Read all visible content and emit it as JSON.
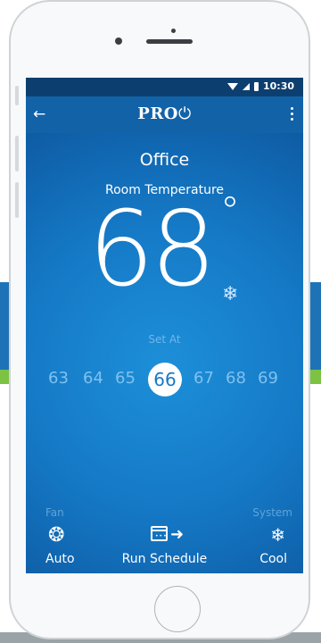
{
  "status_bar": {
    "time": "10:30"
  },
  "app_bar": {
    "logo_text": "PRO"
  },
  "room": {
    "name": "Office",
    "label": "Room Temperature"
  },
  "temperature": {
    "current": "68",
    "unit_symbol": "°"
  },
  "setpoint": {
    "label": "Set At",
    "options": [
      "63",
      "64",
      "65",
      "66",
      "67",
      "68",
      "69"
    ],
    "selected": "66"
  },
  "controls": {
    "fan": {
      "label": "Fan",
      "value": "Auto",
      "icon": "fan-icon"
    },
    "schedule": {
      "value": "Run Schedule",
      "icon": "calendar-arrow-icon"
    },
    "system": {
      "label": "System",
      "value": "Cool",
      "icon": "snowflake-icon"
    }
  },
  "colors": {
    "accent_blue": "#1579c6",
    "app_bar": "#1262a8",
    "status_bar": "#0c3f6f",
    "background_band_blue": "#1e73b6",
    "background_band_green": "#7cc243"
  }
}
